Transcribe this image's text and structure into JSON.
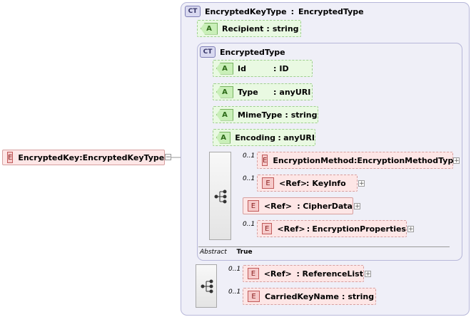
{
  "root": {
    "badge": "E",
    "name": "EncryptedKey",
    "sep": ":",
    "type": "EncryptedKeyType"
  },
  "outer_ct": {
    "badge": "CT",
    "name": "EncryptedKeyType",
    "sep": ":",
    "base": "EncryptedType"
  },
  "recipient": {
    "badge": "A",
    "name": "Recipient",
    "sep": ":",
    "type": "string"
  },
  "inner_ct": {
    "badge": "CT",
    "name": "EncryptedType"
  },
  "attributes": [
    {
      "badge": "A",
      "name": "Id",
      "sep": ":",
      "type": "ID"
    },
    {
      "badge": "A",
      "name": "Type",
      "sep": ":",
      "type": "anyURI"
    },
    {
      "badge": "A",
      "name": "MimeType",
      "sep": ":",
      "type": "string"
    },
    {
      "badge": "A",
      "name": "Encoding",
      "sep": ":",
      "type": "anyURI"
    }
  ],
  "inner_elements": [
    {
      "occurs": "0..1",
      "badge": "E",
      "name": "EncryptionMethod",
      "sep": ":",
      "type": "EncryptionMethodType",
      "plus": "+"
    },
    {
      "occurs": "0..1",
      "badge": "E",
      "ref": "<Ref>",
      "sep": ":",
      "name": "KeyInfo",
      "plus": "+"
    },
    {
      "occurs": "",
      "badge": "E",
      "ref": "<Ref>",
      "sep": ":",
      "name": "CipherData",
      "plus": "+"
    },
    {
      "occurs": "0..1",
      "badge": "E",
      "ref": "<Ref>",
      "sep": ":",
      "name": "EncryptionProperties",
      "plus": "+"
    }
  ],
  "abstract": {
    "label": "Abstract",
    "value": "True"
  },
  "outer_elements": [
    {
      "occurs": "0..1",
      "badge": "E",
      "ref": "<Ref>",
      "sep": ":",
      "name": "ReferenceList",
      "plus": "+"
    },
    {
      "occurs": "0..1",
      "badge": "E",
      "name": "CarriedKeyName",
      "sep": ":",
      "type": "string"
    }
  ],
  "collapse_symbol": "−"
}
